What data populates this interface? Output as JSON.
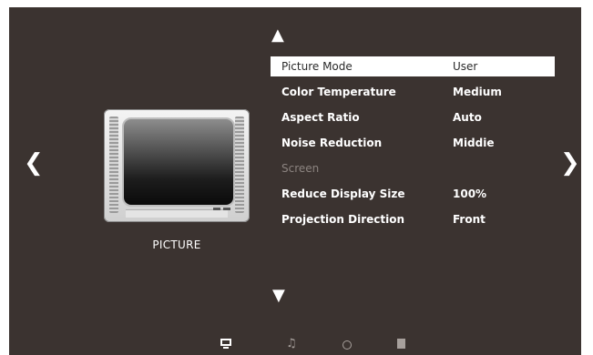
{
  "nav": {
    "up_icon": "up-arrow-icon",
    "down_icon": "down-arrow-icon",
    "left_icon": "left-chevron-icon",
    "right_icon": "right-chevron-icon"
  },
  "section": {
    "label": "PICTURE",
    "icon": "tv-icon"
  },
  "menu": {
    "items": [
      {
        "label": "Picture Mode",
        "value": "User",
        "selected": true
      },
      {
        "label": "Color Temperature",
        "value": "Medium"
      },
      {
        "label": "Aspect Ratio",
        "value": "Auto"
      },
      {
        "label": "Noise Reduction",
        "value": "Middie"
      },
      {
        "label": "Screen",
        "value": "",
        "disabled": true
      },
      {
        "label": "Reduce Display Size",
        "value": "100%"
      },
      {
        "label": "Projection Direction",
        "value": "Front"
      }
    ]
  },
  "bottom_tabs": [
    {
      "icon": "monitor-icon",
      "active": true
    },
    {
      "icon": "music-note-icon"
    },
    {
      "icon": "clock-icon"
    },
    {
      "icon": "lock-icon"
    }
  ],
  "colors": {
    "background": "#3b3330",
    "highlight": "#ffffff",
    "disabled_text": "#8c8480"
  }
}
